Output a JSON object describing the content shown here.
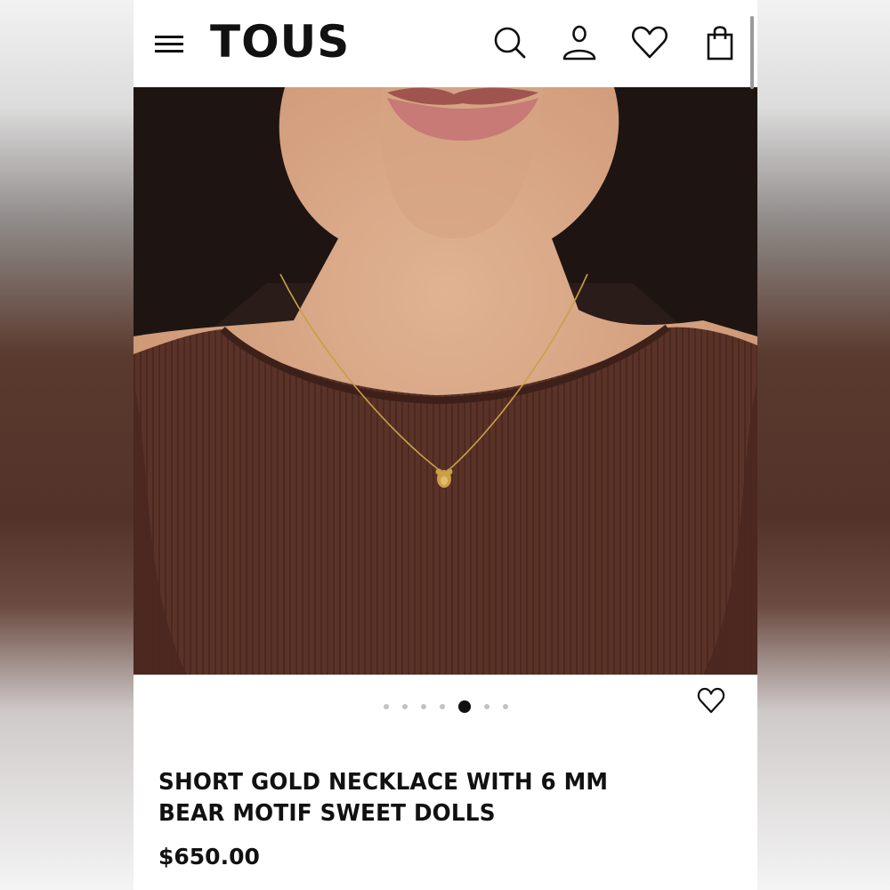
{
  "header": {
    "logo": "TOUS",
    "icons": [
      "menu-icon",
      "search-icon",
      "account-icon",
      "wishlist-icon",
      "shopping-bag-icon"
    ]
  },
  "gallery": {
    "image_count": 7,
    "active_index": 4,
    "wishlist_icon": "heart-outline-icon"
  },
  "product": {
    "title": "SHORT GOLD NECKLACE WITH 6 MM BEAR MOTIF SWEET DOLLS",
    "price": "$650.00"
  },
  "colors": {
    "text": "#111111",
    "dot_inactive": "#c2c2c2",
    "sweater": "#5a3228",
    "gold": "#c9a046"
  }
}
